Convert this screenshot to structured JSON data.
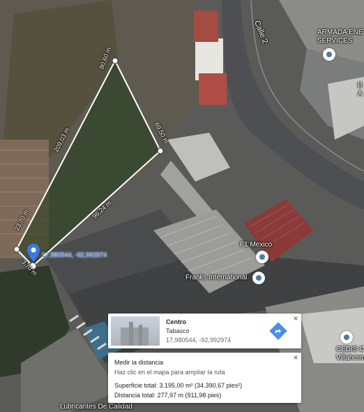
{
  "map": {
    "road_label": "Calle 2",
    "places": [
      {
        "name": "ARMADA ENE",
        "name2": "SERVICES"
      },
      {
        "name": "F1 Mexico"
      },
      {
        "name": "Franks International"
      },
      {
        "name": "CEDIS Ca",
        "name2": "Villaherm"
      },
      {
        "name": "Lubricantes De Calidad"
      },
      {
        "name": "B",
        "name2": "A"
      }
    ],
    "measure_labels": {
      "edge_top": "80,60 m",
      "edge_left": "209,03 m",
      "edge_right": "69,50 m",
      "edge_bottom": "96,24 m",
      "edge_left_low": "23,70 m",
      "edge_bottom_low": "3,70 m",
      "pin_coords": "17,980544, -92,992974"
    }
  },
  "place_card": {
    "title": "Centro",
    "subtitle": "Tabasco",
    "coords": "17,980544, -92,992974",
    "close": "×"
  },
  "measure_card": {
    "title": "Medir la distancia",
    "hint": "Haz clic en el mapa para ampliar la ruta",
    "area": "Superficie total: 3.195,00 m² (34.390,67 pies²)",
    "distance": "Distancia total: 277,97 m (911,98 pies)",
    "close": "×"
  },
  "colors": {
    "pin_blue": "#3b78e7",
    "dir_blue": "#4a90e2",
    "measure_line": "#ffffff",
    "area_fill": "#1f3a1c"
  },
  "icons": [
    "location-pin-icon",
    "directions-icon",
    "close-icon",
    "place-marker-icon",
    "street-view-thumbnail"
  ]
}
